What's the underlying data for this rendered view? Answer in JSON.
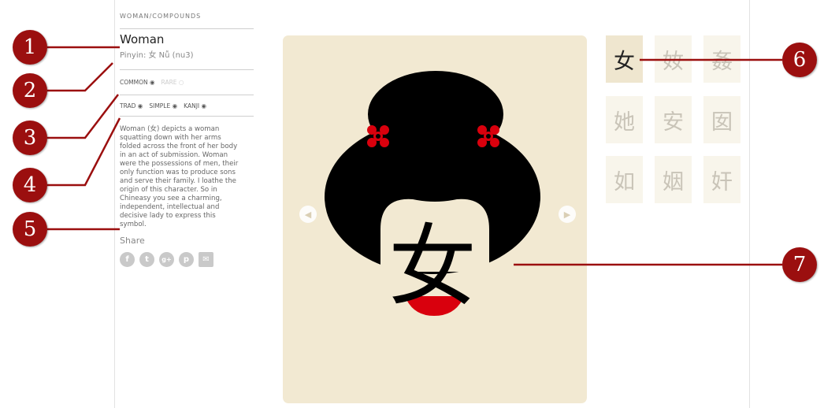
{
  "breadcrumb": "WOMAN/COMPOUNDS",
  "title": "Woman",
  "pinyin": "Pinyin: 女 Nǚ (nu3)",
  "frequency": {
    "common": "COMMON",
    "rare": "RARE"
  },
  "script_options": [
    "TRAD",
    "SIMPLE",
    "KANJI"
  ],
  "description": "Woman (女) depicts a woman squatting down with her arms folded across the front of her body in an act of submission. Woman were the possessions of men, their only function was to produce sons and serve their family. I loathe the origin of this character. So in Chineasy you see a charming, independent, intellectual and decisive lady to express this symbol.",
  "share": {
    "label": "Share",
    "icons": [
      {
        "name": "facebook-icon",
        "glyph": "f"
      },
      {
        "name": "twitter-icon",
        "glyph": "t"
      },
      {
        "name": "google-plus-icon",
        "glyph": "g+"
      },
      {
        "name": "pinterest-icon",
        "glyph": "p"
      },
      {
        "name": "email-icon",
        "glyph": "✉"
      }
    ]
  },
  "illustration": {
    "character": "女"
  },
  "nav": {
    "prev_icon": "chevron-left-icon",
    "next_icon": "chevron-right-icon"
  },
  "compounds": [
    "女",
    "奻",
    "姦",
    "她",
    "安",
    "囡",
    "如",
    "姻",
    "奸"
  ],
  "callouts": [
    "1",
    "2",
    "3",
    "4",
    "5",
    "6",
    "7"
  ],
  "colors": {
    "callout": "#9b0f0f",
    "card_bg": "#f2e9d2",
    "active_tile": "#efe6cf",
    "accent_red": "#d9000d"
  }
}
